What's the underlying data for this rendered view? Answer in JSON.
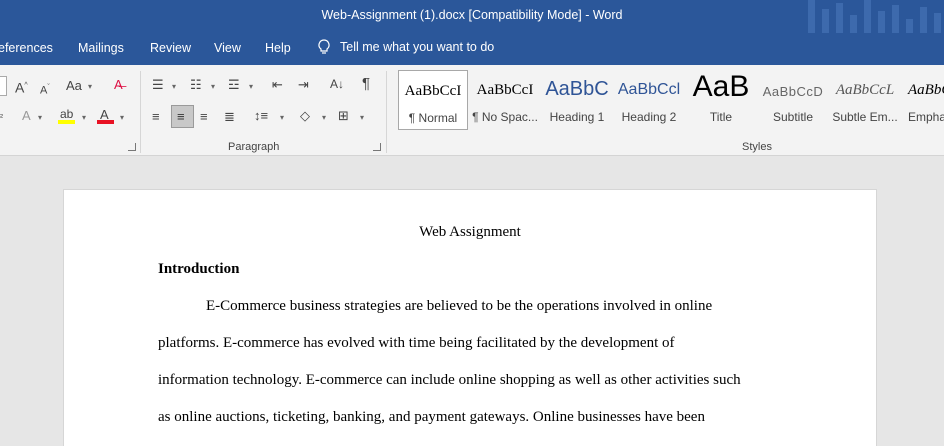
{
  "window": {
    "title": "Web-Assignment (1).docx [Compatibility Mode]  -  Word"
  },
  "tabs": [
    "eferences",
    "Mailings",
    "Review",
    "View",
    "Help"
  ],
  "tell_me": "Tell me what you want to do",
  "ribbon": {
    "paragraph_label": "Paragraph",
    "styles_label": "Styles",
    "styles": [
      {
        "sample": "AaBbCcI",
        "name": "¶ Normal"
      },
      {
        "sample": "AaBbCcI",
        "name": "¶ No Spac..."
      },
      {
        "sample": "AaBbC",
        "name": "Heading 1"
      },
      {
        "sample": "AaBbCcl",
        "name": "Heading 2"
      },
      {
        "sample": "AaB",
        "name": "Title"
      },
      {
        "sample": "AaBbCcD",
        "name": "Subtitle"
      },
      {
        "sample": "AaBbCcL",
        "name": "Subtle Em..."
      },
      {
        "sample": "AaBbC",
        "name": "Empha"
      }
    ]
  },
  "document": {
    "title": "Web Assignment",
    "heading": "Introduction",
    "lines": [
      "E-Commerce business strategies are believed to be the operations involved in online",
      "platforms. E-commerce has evolved with time being facilitated by the development of",
      "information technology. E-commerce can include online shopping as well as other activities such",
      "as online auctions, ticketing, banking, and payment gateways. Online businesses have been"
    ]
  },
  "colors": {
    "word_blue": "#2b579a",
    "highlight_yellow": "#ffff00",
    "font_color_red": "#e81123"
  },
  "icons": [
    "lightbulb-icon",
    "grow-font-icon",
    "shrink-font-icon",
    "change-case-icon",
    "clear-formatting-icon",
    "bullets-icon",
    "numbering-icon",
    "multilevel-list-icon",
    "decrease-indent-icon",
    "increase-indent-icon",
    "sort-icon",
    "show-formatting-icon",
    "align-left-icon",
    "center-icon",
    "align-right-icon",
    "justify-icon",
    "line-spacing-icon",
    "shading-icon",
    "borders-icon",
    "text-effects-icon",
    "highlight-icon",
    "font-color-icon"
  ]
}
